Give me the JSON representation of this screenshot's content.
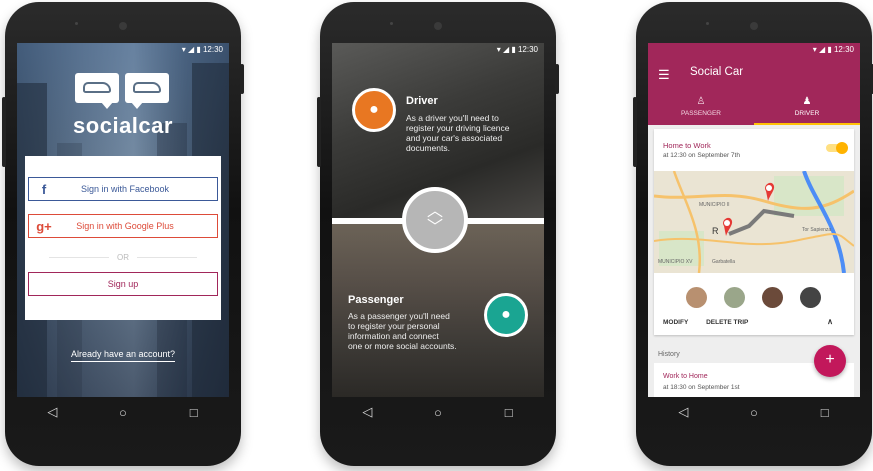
{
  "phone1": {
    "statusbar": "▾ ◢ ▮ 12:30",
    "brand": "socialcar",
    "facebook_icon": "f",
    "facebook_label": "Sign in with Facebook",
    "google_icon": "g+",
    "google_label": "Sign in with Google Plus",
    "or_label": "OR",
    "signup_label": "Sign up",
    "already_label": "Already have an account?",
    "colors": {
      "facebook": "#3b5998",
      "google": "#dd4b39",
      "brand": "#a1275a"
    }
  },
  "phone2": {
    "statusbar": "▾ ◢ ▮ 12:30",
    "driver_title": "Driver",
    "driver_desc_1": "As a driver you'll need to",
    "driver_desc_2": "register your driving licence",
    "driver_desc_3": "and your car's associated",
    "driver_desc_4": "documents.",
    "passenger_title": "Passenger",
    "passenger_desc_1": "As a passenger you'll need",
    "passenger_desc_2": "to register your personal",
    "passenger_desc_3": "information and connect",
    "passenger_desc_4": "one or more social accounts.",
    "colors": {
      "driver": "#e87722",
      "passenger": "#1aa592"
    }
  },
  "phone3": {
    "statusbar": "▾ ◢ ▮ 12:30",
    "app_title": "Social Car",
    "tabs": [
      {
        "label": "PASSENGER",
        "active": false
      },
      {
        "label": "DRIVER",
        "active": true
      }
    ],
    "trip_name": "Home to Work",
    "trip_time": "at 12:30 on September 7th",
    "map_labels": [
      "MUNICIPIO II",
      "Tor Sapienza",
      "Garbatella",
      "MUNICIPIO XV",
      "R"
    ],
    "actions": [
      "MODIFY",
      "DELETE TRIP"
    ],
    "history_label": "History",
    "history_name": "Work to Home",
    "history_time": "at 18:30 on September 1st",
    "fab_label": "+",
    "colors": {
      "primary": "#a1275a",
      "accent": "#ffc107",
      "fab": "#c2185b"
    }
  },
  "navbar": {
    "back": "◁",
    "home": "○",
    "recent": "□"
  }
}
